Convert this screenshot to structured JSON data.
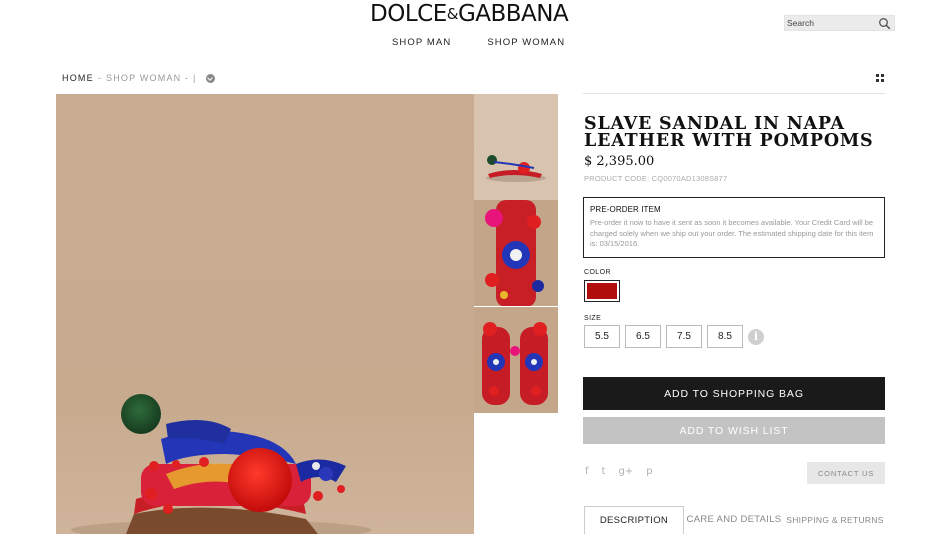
{
  "header": {
    "logo_left": "DOLCE",
    "logo_amp": "&",
    "logo_right": "GABBANA",
    "nav": [
      "SHOP MAN",
      "SHOP WOMAN"
    ],
    "search_placeholder": "Search"
  },
  "breadcrumb": {
    "home": "HOME",
    "separator": "-",
    "current": "SHOP WOMAN - |"
  },
  "product": {
    "title": "SLAVE SANDAL IN NAPA LEATHER WITH POMPOMS",
    "price": "$ 2,395.00",
    "product_code": "PRODUCT CODE: CQ0070AD1308S877",
    "preorder_heading": "PRE-ORDER ITEM",
    "preorder_text": "Pre-order it now to have it sent as soon it becomes available. Your Credit Card will be charged solely when we ship out your order. The estimated shipping date for this item is: 03/15/2016.",
    "color_label": "COLOR",
    "color_value": "#b00d0d",
    "size_label": "SIZE",
    "sizes": [
      "5.5",
      "6.5",
      "7.5",
      "8.5"
    ],
    "info_symbol": "i"
  },
  "actions": {
    "add_to_bag": "ADD TO SHOPPING BAG",
    "add_to_wishlist": "ADD TO WISH LIST",
    "contact_us": "CONTACT US",
    "social": [
      "f",
      "t",
      "g+",
      "p"
    ]
  },
  "tabs": [
    "DESCRIPTION",
    "CARE AND DETAILS",
    "SHIPPING & RETURNS"
  ],
  "colors": {
    "accent_dark": "#1a1a1a",
    "wish_grey": "#c3c3c3",
    "backdrop_beige": "#c9ad93"
  },
  "icons": [
    "search-icon",
    "chevron-circle-icon",
    "grid-view-icon",
    "info-icon",
    "facebook-icon",
    "twitter-icon",
    "google-plus-icon",
    "pinterest-icon"
  ]
}
